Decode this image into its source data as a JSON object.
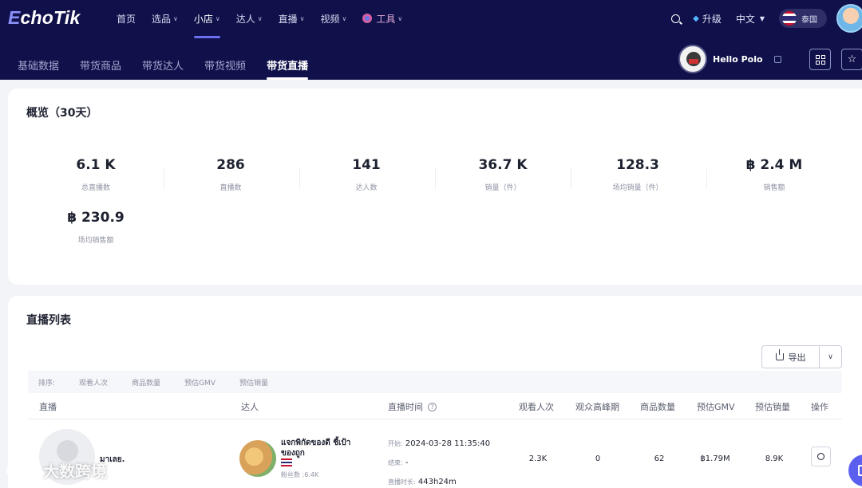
{
  "app": {
    "logo_prefix": "E",
    "logo_rest": "choTik"
  },
  "main_nav": [
    {
      "label": "首页",
      "has_menu": false
    },
    {
      "label": "选品",
      "has_menu": true
    },
    {
      "label": "小店",
      "has_menu": true,
      "active": true
    },
    {
      "label": "达人",
      "has_menu": true
    },
    {
      "label": "直播",
      "has_menu": true
    },
    {
      "label": "视频",
      "has_menu": true
    },
    {
      "label": "工具",
      "has_menu": true
    }
  ],
  "header_right": {
    "upgrade_label": "升级",
    "language_label": "中文",
    "country_label": "泰国"
  },
  "sub_nav": [
    {
      "label": "基础数据"
    },
    {
      "label": "带货商品"
    },
    {
      "label": "带货达人"
    },
    {
      "label": "带货视频"
    },
    {
      "label": "带货直播",
      "active": true
    }
  ],
  "shop": {
    "name": "Hello Polo"
  },
  "overview": {
    "title": "概览（30天）",
    "stats": [
      {
        "value": "6.1 K",
        "label": "总直播数"
      },
      {
        "value": "286",
        "label": "直播数"
      },
      {
        "value": "141",
        "label": "达人数"
      },
      {
        "value": "36.7 K",
        "label": "销量（件）"
      },
      {
        "value": "128.3",
        "label": "场均销量（件）"
      },
      {
        "value": "฿ 2.4 M",
        "label": "销售额"
      },
      {
        "value": "฿ 230.9",
        "label": "场均销售额"
      }
    ]
  },
  "live_list": {
    "title": "直播列表",
    "export_label": "导出",
    "sort_label": "排序:",
    "sort_options": [
      "观看人次",
      "商品数量",
      "预估GMV",
      "预估销量"
    ],
    "columns": {
      "live": "直播",
      "creator": "达人",
      "time": "直播时间",
      "views": "观看人次",
      "peak": "观众高峰期",
      "products": "商品数量",
      "gmv": "预估GMV",
      "sales": "预估销量",
      "action": "操作"
    },
    "rows": [
      {
        "live_name": "มาเลย.",
        "creator_name": "แจกพิกัดของดี ชี้เป้าของถูก",
        "fans": "粉丝数 :6.4K",
        "start_key": "开始:",
        "start_value": "2024-03-28 11:35:40",
        "end_key": "结束:",
        "end_value": "-",
        "duration_key": "直播时长:",
        "duration_value": "443h24m",
        "views": "2.3K",
        "peak": "0",
        "products": "62",
        "gmv": "฿1.79M",
        "sales": "8.9K"
      }
    ]
  },
  "watermark": {
    "text": "大数跨境"
  },
  "colors": {
    "nav_bg": "#10114a",
    "accent": "#6b6ff0",
    "page_bg": "#f3f4f8"
  }
}
